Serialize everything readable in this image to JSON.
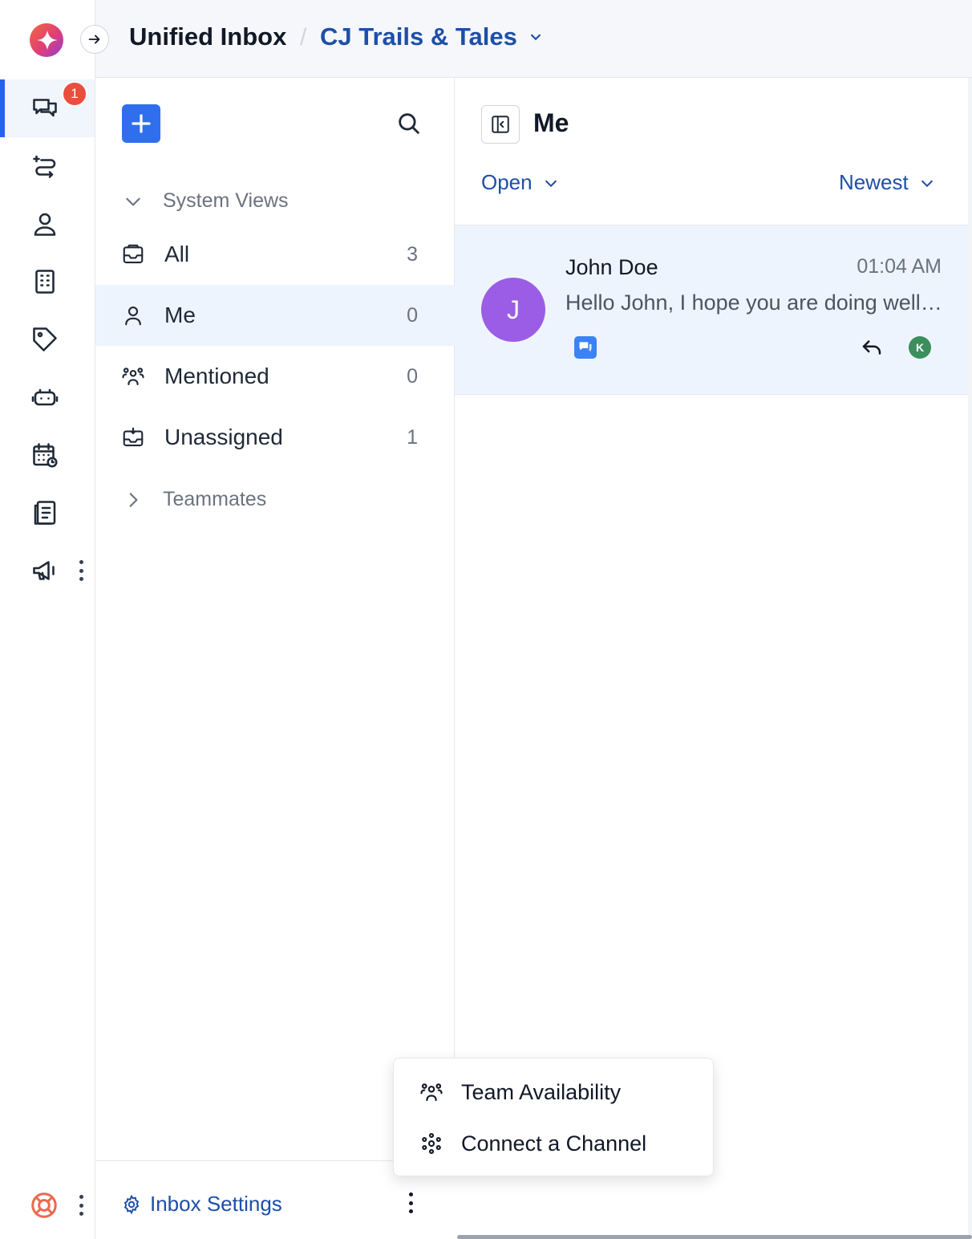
{
  "header": {
    "title": "Unified Inbox",
    "separator": "/",
    "inbox_name": "CJ Trails & Tales"
  },
  "rail": {
    "unread_badge": "1",
    "items": [
      "conversations-icon",
      "captain-icon",
      "contacts-icon",
      "companies-icon",
      "labels-icon",
      "bot-icon",
      "calendar-icon",
      "knowledge-base-icon",
      "campaigns-icon"
    ]
  },
  "views": {
    "system_views_label": "System Views",
    "items": [
      {
        "label": "All",
        "count": "3"
      },
      {
        "label": "Me",
        "count": "0"
      },
      {
        "label": "Mentioned",
        "count": "0"
      },
      {
        "label": "Unassigned",
        "count": "1"
      }
    ],
    "teammates_label": "Teammates",
    "settings_label": "Inbox Settings"
  },
  "conversations": {
    "title": "Me",
    "status_filter": "Open",
    "sort_filter": "Newest",
    "items": [
      {
        "avatar_initial": "J",
        "name": "John Doe",
        "time": "01:04 AM",
        "preview": "Hello John, I hope you are doing well. I wanted to follow up on your recent trip booking.",
        "assignee_initial": "K"
      }
    ]
  },
  "menu": {
    "items": [
      {
        "label": "Team Availability",
        "icon": "team-icon"
      },
      {
        "label": "Connect a Channel",
        "icon": "channel-icon"
      }
    ]
  },
  "colors": {
    "accent": "#2f6fed",
    "link": "#1d4fa8",
    "avatar": "#9b5de5",
    "badge": "#ea4e3d",
    "assignee": "#3a8f5c"
  }
}
